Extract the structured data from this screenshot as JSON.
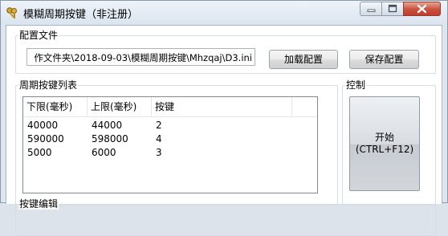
{
  "window": {
    "title": "模糊周期按键（非注册）",
    "app_icon": "keys-icon"
  },
  "config": {
    "group_label": "配置文件",
    "path_value": "作文件夹\\2018-09-03\\模糊周期按键\\Mhzqaj\\D3.ini",
    "load_button": "加载配置",
    "save_button": "保存配置"
  },
  "keylist": {
    "group_label": "周期按键列表",
    "columns": [
      "下限(毫秒)",
      "上限(毫秒)",
      "按键"
    ],
    "rows": [
      {
        "low": "40000",
        "high": "44000",
        "key": "2"
      },
      {
        "low": "590000",
        "high": "598000",
        "key": "4"
      },
      {
        "low": "5000",
        "high": "6000",
        "key": "3"
      }
    ]
  },
  "control": {
    "group_label": "控制",
    "start_label": "开始",
    "start_shortcut": "(CTRL+F12)"
  },
  "edit": {
    "group_label": "按键编辑"
  }
}
